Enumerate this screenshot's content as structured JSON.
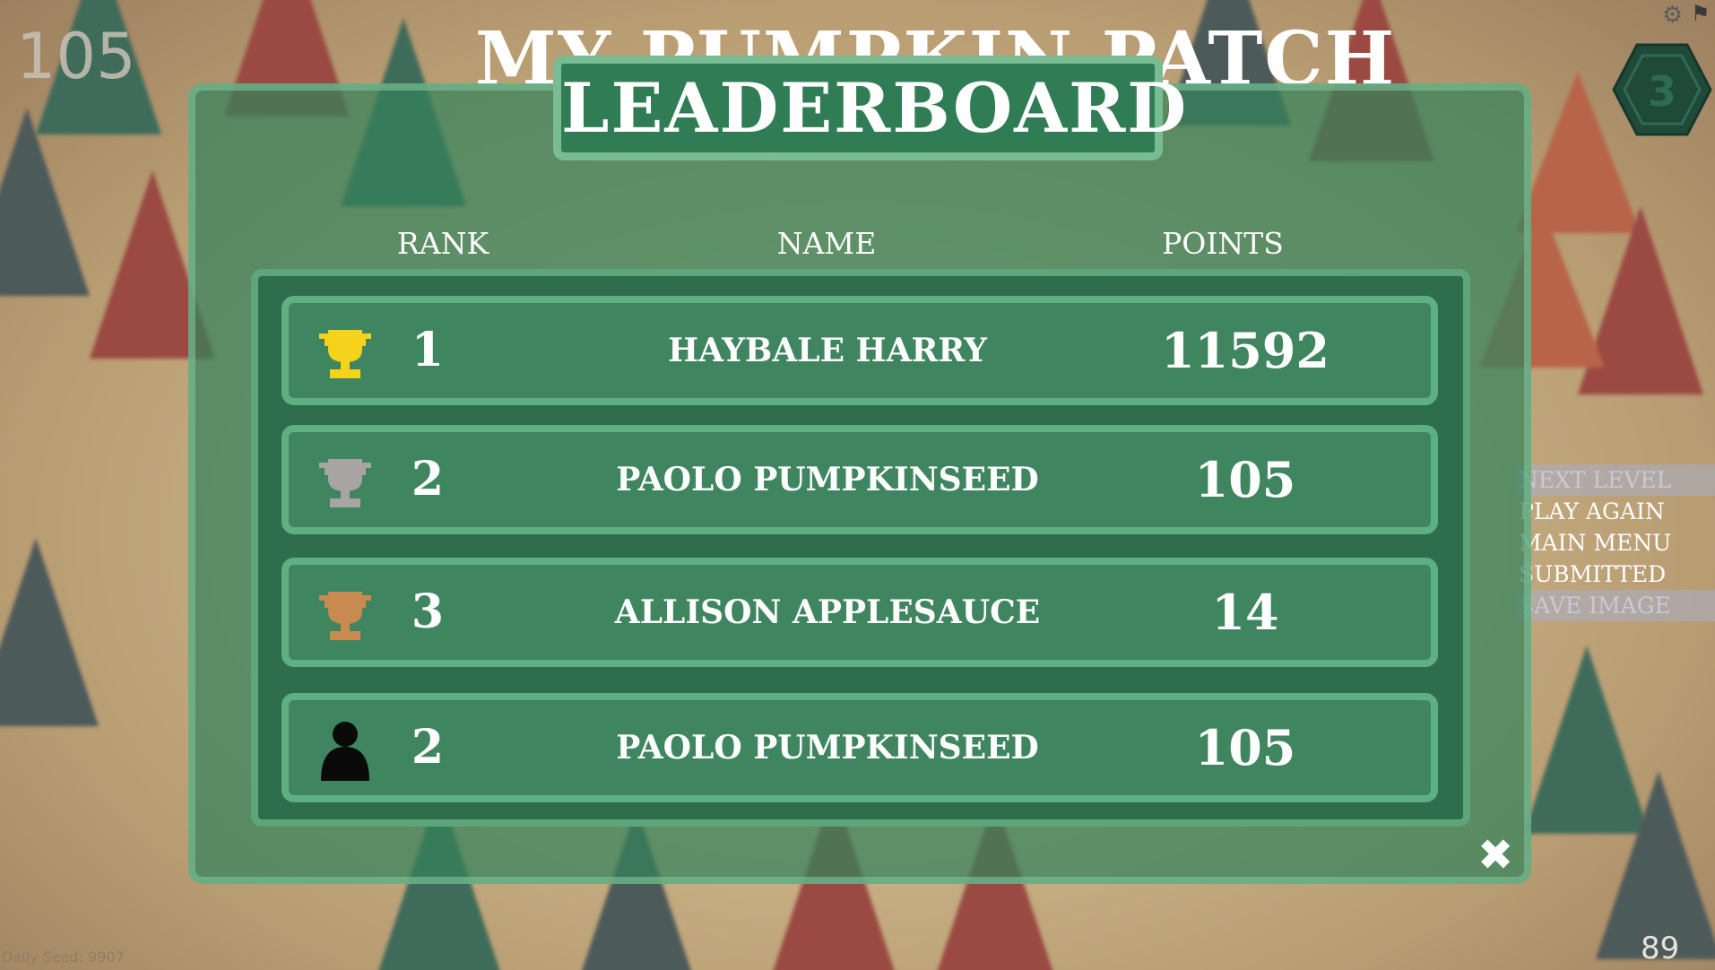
{
  "hud": {
    "score": "105",
    "title": "MY PUMPKIN PATCH",
    "level_number": "3",
    "counter": "89",
    "daily_seed": "Daily Seed: 9907"
  },
  "side_menu": {
    "items": [
      {
        "label": "NEXT LEVEL",
        "state": "disabled"
      },
      {
        "label": "PLAY AGAIN",
        "state": "enabled"
      },
      {
        "label": "MAIN MENU",
        "state": "enabled"
      },
      {
        "label": "SUBMITTED",
        "state": "enabled"
      },
      {
        "label": "SAVE IMAGE",
        "state": "disabled"
      }
    ]
  },
  "leaderboard": {
    "title": "LEADERBOARD",
    "columns": {
      "rank": "RANK",
      "name": "NAME",
      "points": "POINTS"
    },
    "rows": [
      {
        "rank": "1",
        "name": "HAYBALE HARRY",
        "points": "11592",
        "icon": "gold-trophy-icon"
      },
      {
        "rank": "2",
        "name": "PAOLO PUMPKINSEED",
        "points": "105",
        "icon": "silver-trophy-icon"
      },
      {
        "rank": "3",
        "name": "ALLISON APPLESAUCE",
        "points": "14",
        "icon": "bronze-trophy-icon"
      },
      {
        "rank": "2",
        "name": "PAOLO PUMPKINSEED",
        "points": "105",
        "icon": "player-silhouette-icon"
      }
    ],
    "close_symbol": "✖"
  },
  "colors": {
    "gold": "#f5d21b",
    "silver": "#a8a4a4",
    "bronze": "#c88a4e",
    "player": "#0a0a0a",
    "panel": "#3f8660"
  }
}
